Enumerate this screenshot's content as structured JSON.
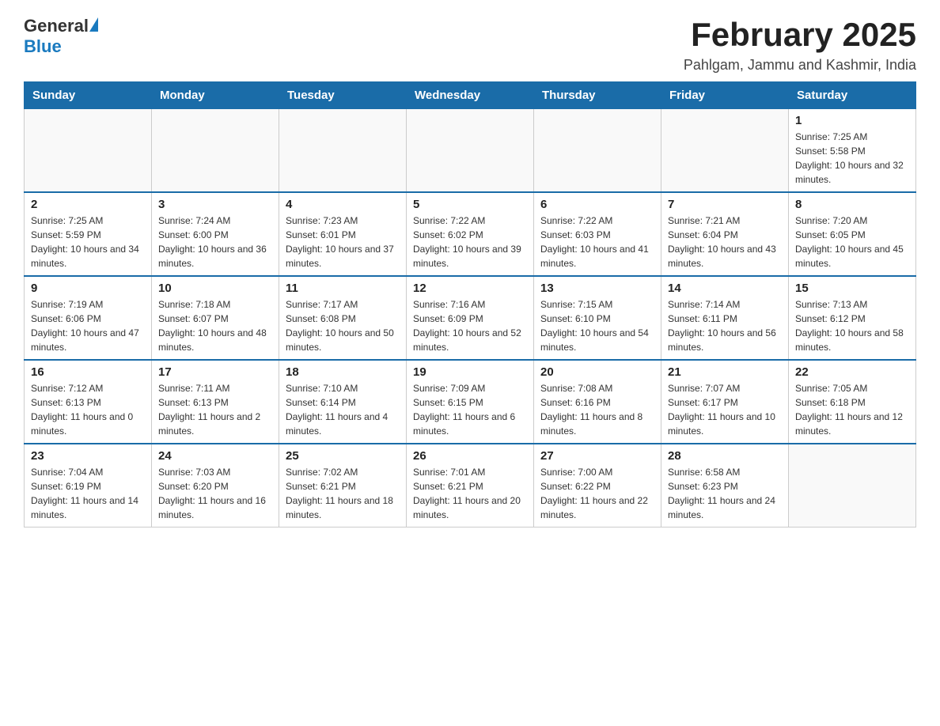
{
  "header": {
    "logo_general": "General",
    "logo_blue": "Blue",
    "title": "February 2025",
    "subtitle": "Pahlgam, Jammu and Kashmir, India"
  },
  "columns": [
    "Sunday",
    "Monday",
    "Tuesday",
    "Wednesday",
    "Thursday",
    "Friday",
    "Saturday"
  ],
  "weeks": [
    [
      {
        "day": "",
        "sunrise": "",
        "sunset": "",
        "daylight": ""
      },
      {
        "day": "",
        "sunrise": "",
        "sunset": "",
        "daylight": ""
      },
      {
        "day": "",
        "sunrise": "",
        "sunset": "",
        "daylight": ""
      },
      {
        "day": "",
        "sunrise": "",
        "sunset": "",
        "daylight": ""
      },
      {
        "day": "",
        "sunrise": "",
        "sunset": "",
        "daylight": ""
      },
      {
        "day": "",
        "sunrise": "",
        "sunset": "",
        "daylight": ""
      },
      {
        "day": "1",
        "sunrise": "Sunrise: 7:25 AM",
        "sunset": "Sunset: 5:58 PM",
        "daylight": "Daylight: 10 hours and 32 minutes."
      }
    ],
    [
      {
        "day": "2",
        "sunrise": "Sunrise: 7:25 AM",
        "sunset": "Sunset: 5:59 PM",
        "daylight": "Daylight: 10 hours and 34 minutes."
      },
      {
        "day": "3",
        "sunrise": "Sunrise: 7:24 AM",
        "sunset": "Sunset: 6:00 PM",
        "daylight": "Daylight: 10 hours and 36 minutes."
      },
      {
        "day": "4",
        "sunrise": "Sunrise: 7:23 AM",
        "sunset": "Sunset: 6:01 PM",
        "daylight": "Daylight: 10 hours and 37 minutes."
      },
      {
        "day": "5",
        "sunrise": "Sunrise: 7:22 AM",
        "sunset": "Sunset: 6:02 PM",
        "daylight": "Daylight: 10 hours and 39 minutes."
      },
      {
        "day": "6",
        "sunrise": "Sunrise: 7:22 AM",
        "sunset": "Sunset: 6:03 PM",
        "daylight": "Daylight: 10 hours and 41 minutes."
      },
      {
        "day": "7",
        "sunrise": "Sunrise: 7:21 AM",
        "sunset": "Sunset: 6:04 PM",
        "daylight": "Daylight: 10 hours and 43 minutes."
      },
      {
        "day": "8",
        "sunrise": "Sunrise: 7:20 AM",
        "sunset": "Sunset: 6:05 PM",
        "daylight": "Daylight: 10 hours and 45 minutes."
      }
    ],
    [
      {
        "day": "9",
        "sunrise": "Sunrise: 7:19 AM",
        "sunset": "Sunset: 6:06 PM",
        "daylight": "Daylight: 10 hours and 47 minutes."
      },
      {
        "day": "10",
        "sunrise": "Sunrise: 7:18 AM",
        "sunset": "Sunset: 6:07 PM",
        "daylight": "Daylight: 10 hours and 48 minutes."
      },
      {
        "day": "11",
        "sunrise": "Sunrise: 7:17 AM",
        "sunset": "Sunset: 6:08 PM",
        "daylight": "Daylight: 10 hours and 50 minutes."
      },
      {
        "day": "12",
        "sunrise": "Sunrise: 7:16 AM",
        "sunset": "Sunset: 6:09 PM",
        "daylight": "Daylight: 10 hours and 52 minutes."
      },
      {
        "day": "13",
        "sunrise": "Sunrise: 7:15 AM",
        "sunset": "Sunset: 6:10 PM",
        "daylight": "Daylight: 10 hours and 54 minutes."
      },
      {
        "day": "14",
        "sunrise": "Sunrise: 7:14 AM",
        "sunset": "Sunset: 6:11 PM",
        "daylight": "Daylight: 10 hours and 56 minutes."
      },
      {
        "day": "15",
        "sunrise": "Sunrise: 7:13 AM",
        "sunset": "Sunset: 6:12 PM",
        "daylight": "Daylight: 10 hours and 58 minutes."
      }
    ],
    [
      {
        "day": "16",
        "sunrise": "Sunrise: 7:12 AM",
        "sunset": "Sunset: 6:13 PM",
        "daylight": "Daylight: 11 hours and 0 minutes."
      },
      {
        "day": "17",
        "sunrise": "Sunrise: 7:11 AM",
        "sunset": "Sunset: 6:13 PM",
        "daylight": "Daylight: 11 hours and 2 minutes."
      },
      {
        "day": "18",
        "sunrise": "Sunrise: 7:10 AM",
        "sunset": "Sunset: 6:14 PM",
        "daylight": "Daylight: 11 hours and 4 minutes."
      },
      {
        "day": "19",
        "sunrise": "Sunrise: 7:09 AM",
        "sunset": "Sunset: 6:15 PM",
        "daylight": "Daylight: 11 hours and 6 minutes."
      },
      {
        "day": "20",
        "sunrise": "Sunrise: 7:08 AM",
        "sunset": "Sunset: 6:16 PM",
        "daylight": "Daylight: 11 hours and 8 minutes."
      },
      {
        "day": "21",
        "sunrise": "Sunrise: 7:07 AM",
        "sunset": "Sunset: 6:17 PM",
        "daylight": "Daylight: 11 hours and 10 minutes."
      },
      {
        "day": "22",
        "sunrise": "Sunrise: 7:05 AM",
        "sunset": "Sunset: 6:18 PM",
        "daylight": "Daylight: 11 hours and 12 minutes."
      }
    ],
    [
      {
        "day": "23",
        "sunrise": "Sunrise: 7:04 AM",
        "sunset": "Sunset: 6:19 PM",
        "daylight": "Daylight: 11 hours and 14 minutes."
      },
      {
        "day": "24",
        "sunrise": "Sunrise: 7:03 AM",
        "sunset": "Sunset: 6:20 PM",
        "daylight": "Daylight: 11 hours and 16 minutes."
      },
      {
        "day": "25",
        "sunrise": "Sunrise: 7:02 AM",
        "sunset": "Sunset: 6:21 PM",
        "daylight": "Daylight: 11 hours and 18 minutes."
      },
      {
        "day": "26",
        "sunrise": "Sunrise: 7:01 AM",
        "sunset": "Sunset: 6:21 PM",
        "daylight": "Daylight: 11 hours and 20 minutes."
      },
      {
        "day": "27",
        "sunrise": "Sunrise: 7:00 AM",
        "sunset": "Sunset: 6:22 PM",
        "daylight": "Daylight: 11 hours and 22 minutes."
      },
      {
        "day": "28",
        "sunrise": "Sunrise: 6:58 AM",
        "sunset": "Sunset: 6:23 PM",
        "daylight": "Daylight: 11 hours and 24 minutes."
      },
      {
        "day": "",
        "sunrise": "",
        "sunset": "",
        "daylight": ""
      }
    ]
  ]
}
